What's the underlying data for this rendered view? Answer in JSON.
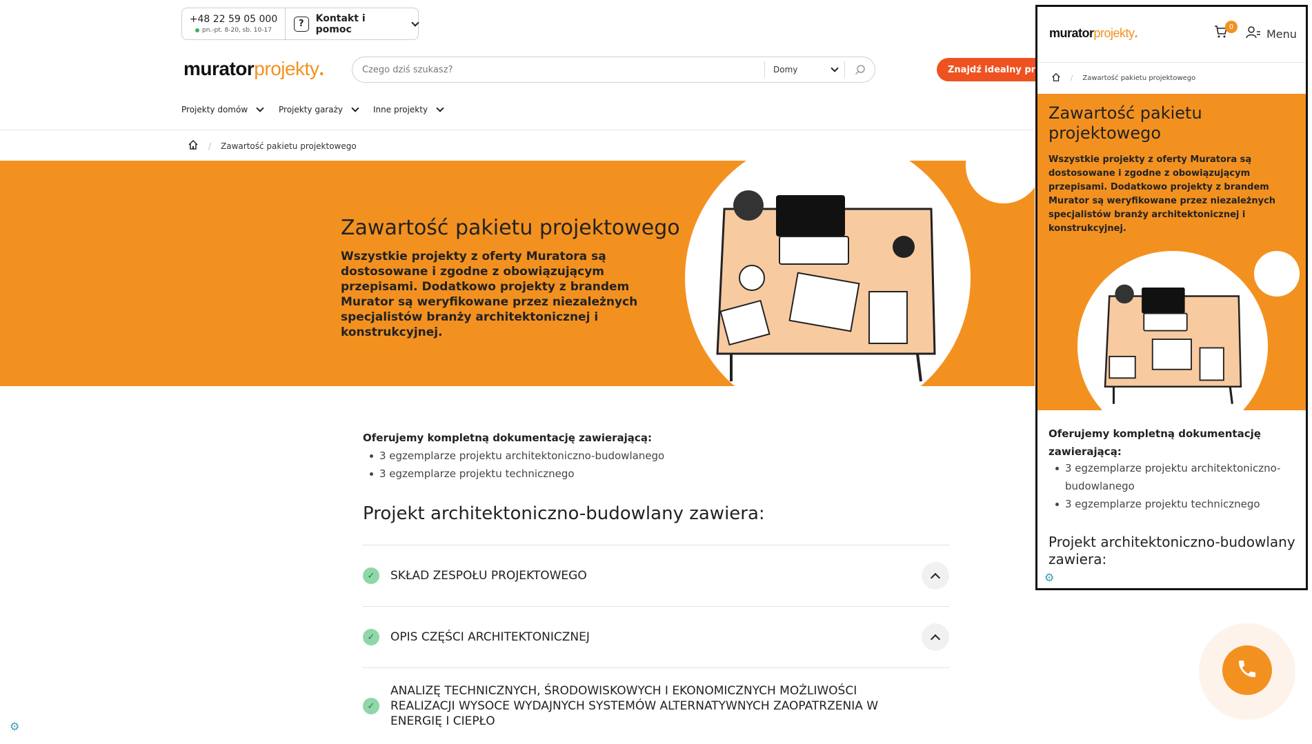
{
  "contact": {
    "phone": "+48 22 59 05 000",
    "hours": "pn.-pt. 8-20, sb. 10-17",
    "help_label": "Kontakt i pomoc"
  },
  "logo": {
    "part1": "murator",
    "part2": "projekty",
    "dot": "."
  },
  "search": {
    "placeholder": "Czego dziś szukasz?",
    "category": "Domy"
  },
  "cta_label": "Znajdź idealny proj",
  "nav": [
    "Projekty domów",
    "Projekty garaży",
    "Inne projekty"
  ],
  "breadcrumb": {
    "current": "Zawartość pakietu projektowego"
  },
  "hero": {
    "title": "Zawartość pakietu projektowego",
    "text": "Wszystkie projekty z oferty Muratora są dostosowane i zgodne z obowiązującym przepisami. Dodatkowo projekty z brandem Murator są weryfikowane przez niezależnych specjalistów branży architektonicznej i konstrukcyjnej."
  },
  "content": {
    "intro": "Oferujemy kompletną dokumentację zawierającą:",
    "list": [
      "3 egzemplarze projektu architektoniczno-budowlanego",
      "3 egzemplarze projektu technicznego"
    ],
    "section_title": "Projekt architektoniczno-budowlany zawiera:",
    "accordion": [
      {
        "title": "SKŁAD ZESPOŁU PROJEKTOWEGO"
      },
      {
        "title": "OPIS CZĘŚCI ARCHITEKTONICZNEJ"
      },
      {
        "title": "ANALIZĘ TECHNICZNYCH, ŚRODOWISKOWYCH I EKONOMICZNYCH MOŻLIWOŚCI REALIZACJI WYSOCE WYDAJNYCH SYSTEMÓW ALTERNATYWNYCH ZAOPATRZENIA W ENERGIĘ I CIEPŁO"
      }
    ]
  },
  "mobile": {
    "cart_count": "0",
    "menu_label": "Menu"
  },
  "colors": {
    "brand": "#f39120",
    "cta": "#ee5220",
    "check": "#8fd6a9"
  }
}
